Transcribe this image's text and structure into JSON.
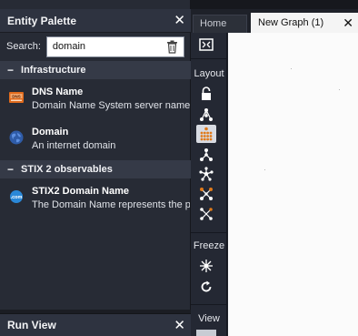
{
  "palette": {
    "title": "Entity Palette",
    "close_icon": "close-icon",
    "search": {
      "label": "Search:",
      "value": "domain",
      "clear_icon": "trash-icon"
    },
    "sections": [
      {
        "title": "Infrastructure",
        "collapse_symbol": "−",
        "items": [
          {
            "name": "DNS Name",
            "description": "Domain Name System server name",
            "icon": "dns-icon"
          },
          {
            "name": "Domain",
            "description": "An internet domain",
            "icon": "globe-icon"
          }
        ]
      },
      {
        "title": "STIX 2 observables",
        "collapse_symbol": "−",
        "items": [
          {
            "name": "STIX2 Domain Name",
            "description": "The Domain Name represents the pr",
            "icon": "com-domain-icon"
          }
        ]
      }
    ]
  },
  "run_view": {
    "title": "Run View",
    "close_icon": "close-icon"
  },
  "tabs": [
    {
      "label": "Home",
      "active": false
    },
    {
      "label": "New Graph (1)",
      "active": true,
      "close_icon": "close-icon"
    }
  ],
  "toolbar": {
    "layout_label": "Layout",
    "freeze_label": "Freeze",
    "view_label": "View",
    "buttons": [
      "fit-to-view-icon",
      "lock-layout-icon",
      "hierarchical-layout-icon",
      "block-layout-icon",
      "tree-layout-icon",
      "organic-layout-icon",
      "interactive-layout-icon",
      "circular-layout-icon",
      "freeze-icon",
      "refresh-icon"
    ]
  },
  "colors": {
    "panel_bg": "#272b35",
    "header_bg": "#2e3340",
    "section_bg": "#353a47",
    "canvas_bg": "#fbfbfb",
    "dns_orange": "#e06a1c",
    "globe_blue": "#4a7fd4"
  }
}
